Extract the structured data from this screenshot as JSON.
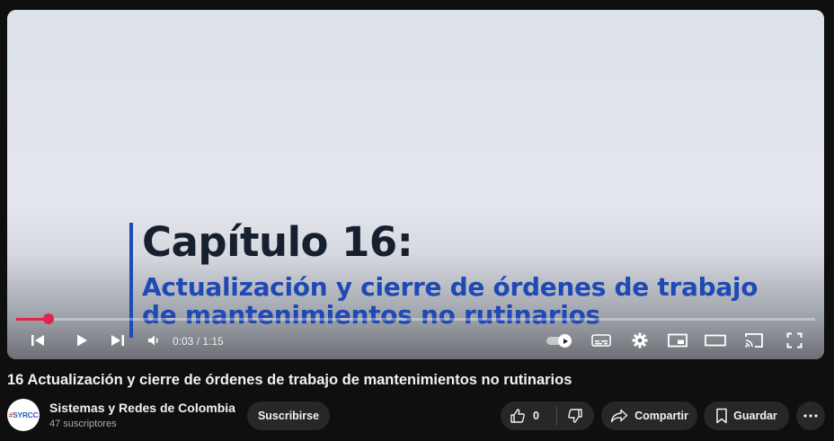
{
  "video": {
    "slide_title": "Capítulo 16:",
    "slide_subtitle": "Actualización y cierre de órdenes de trabajo de mantenimientos no rutinarios",
    "progress_fraction": 0.04
  },
  "controls": {
    "time": "0:03 / 1:15",
    "autoplay_on": true,
    "icons": [
      "previous-icon",
      "play-icon",
      "next-icon",
      "volume-icon",
      "autoplay-toggle",
      "subtitles-icon",
      "settings-gear-icon",
      "miniplayer-icon",
      "theater-mode-icon",
      "cast-icon",
      "fullscreen-icon"
    ]
  },
  "title": "16 Actualización y cierre de órdenes de trabajo de mantenimientos no rutinarios",
  "channel": {
    "avatar_prefix": "#",
    "avatar_text": "SYRCC",
    "name": "Sistemas y Redes de Colombia",
    "subscribers": "47 suscriptores"
  },
  "actions": {
    "subscribe": "Suscribirse",
    "like_count": "0",
    "share": "Compartir",
    "save": "Guardar"
  },
  "colors": {
    "accent_red": "#e0244a",
    "slide_blue": "#1f49b5",
    "pill_bg": "#272727"
  }
}
